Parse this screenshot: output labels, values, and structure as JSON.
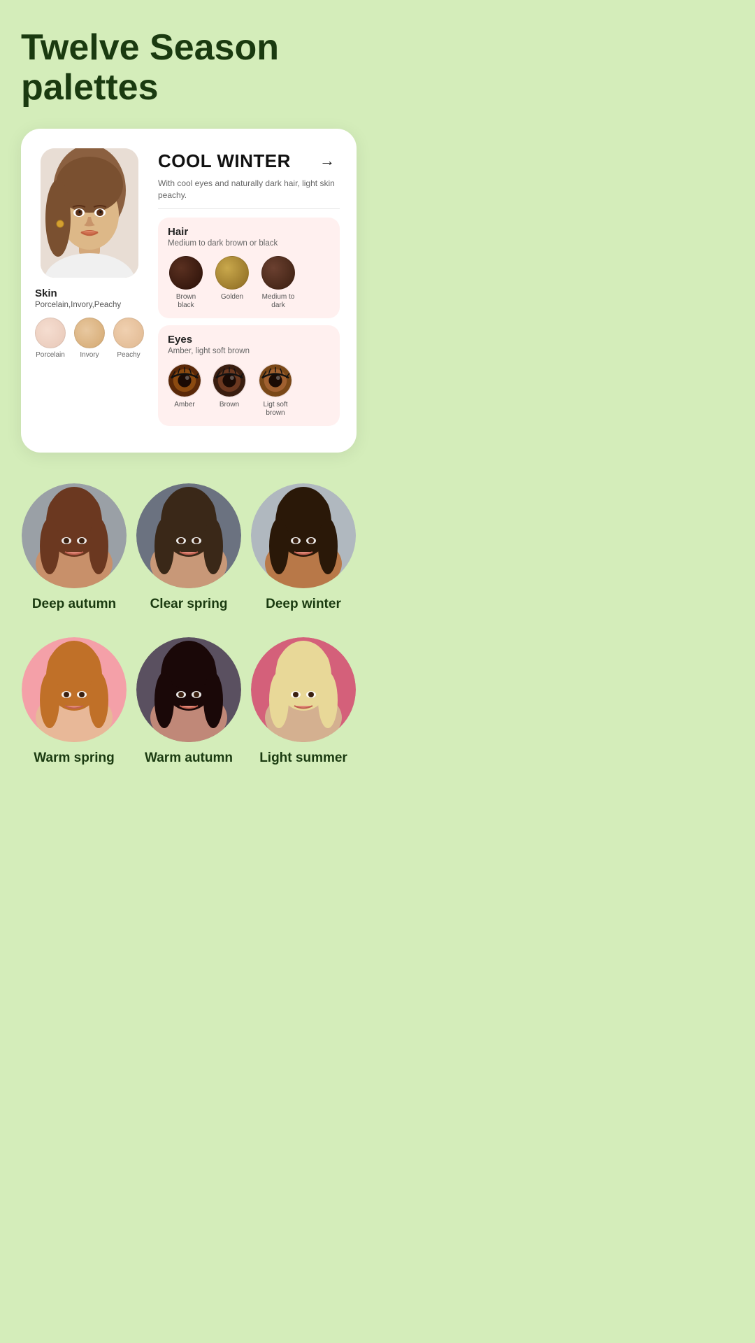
{
  "page": {
    "title_line1": "Twelve Season",
    "title_line2": "palettes"
  },
  "card": {
    "season_name": "COOL WINTER",
    "season_desc": "With cool eyes and naturally dark hair, light skin peachy.",
    "arrow": "→",
    "skin": {
      "title": "Skin",
      "subtitle": "Porcelain,Invory,Peachy",
      "swatches": [
        {
          "label": "Porcelain",
          "color_class": "skin-porcelain"
        },
        {
          "label": "Invory",
          "color_class": "skin-ivory"
        },
        {
          "label": "Peachy",
          "color_class": "skin-peachy"
        }
      ]
    },
    "hair": {
      "title": "Hair",
      "subtitle": "Medium to dark brown or black",
      "swatches": [
        {
          "label": "Brown black",
          "color_class": "hair-brown-black"
        },
        {
          "label": "Golden",
          "color_class": "hair-golden"
        },
        {
          "label": "Medium to dark",
          "color_class": "hair-medium-dark"
        }
      ]
    },
    "eyes": {
      "title": "Eyes",
      "subtitle": "Amber, light soft brown",
      "swatches": [
        {
          "label": "Amber",
          "iris_color": "#8b4a10",
          "outer": "#5a2808"
        },
        {
          "label": "Brown",
          "iris_color": "#6b3820",
          "outer": "#3a1e10"
        },
        {
          "label": "Ligt soft brown",
          "iris_color": "#a06030",
          "outer": "#7a4818"
        }
      ]
    }
  },
  "faces_row1": [
    {
      "label": "Deep autumn",
      "bg": "#7a6058"
    },
    {
      "label": "Clear spring",
      "bg": "#5a6068"
    },
    {
      "label": "Deep winter",
      "bg": "#8a8890"
    }
  ],
  "faces_row2": [
    {
      "label": "Warm spring",
      "bg": "#f4a0a8"
    },
    {
      "label": "Warm autumn",
      "bg": "#5a5060"
    },
    {
      "label": "Light summer",
      "bg": "#d4607a"
    }
  ]
}
